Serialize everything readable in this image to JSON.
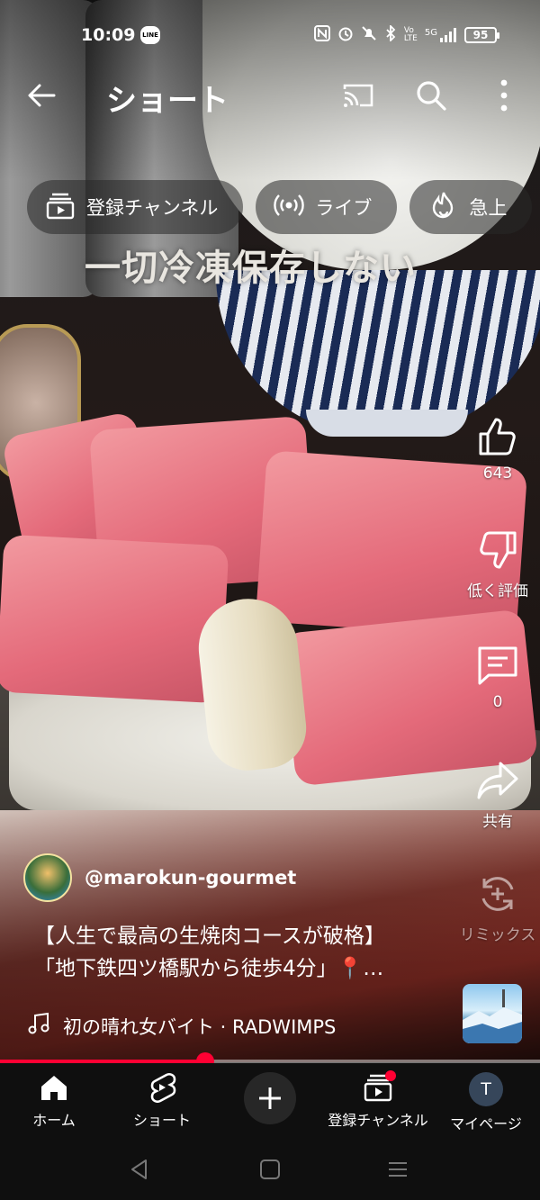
{
  "status_bar": {
    "time": "10:09",
    "line_badge": "LINE",
    "network": "5G",
    "battery": "95"
  },
  "app_bar": {
    "title": "ショート"
  },
  "chips": [
    {
      "label": "登録チャンネル",
      "icon": "subscriptions-icon"
    },
    {
      "label": "ライブ",
      "icon": "live-icon"
    },
    {
      "label": "急上",
      "icon": "trending-icon"
    }
  ],
  "video": {
    "caption_overlay": "一切冷凍保存しない",
    "channel_handle": "@marokun-gourmet",
    "description_line1": "【人生で最高の生焼肉コースが破格】",
    "description_line2": "「地下鉄四ツ橋駅から徒歩4分」📍…",
    "music": "初の晴れ女バイト · RADWIMPS",
    "progress_fraction": 0.38
  },
  "actions": {
    "like_count": "643",
    "dislike_label": "低く評価",
    "comment_count": "0",
    "share_label": "共有",
    "remix_label": "リミックス"
  },
  "bottom_nav": {
    "home": "ホーム",
    "shorts": "ショート",
    "subscriptions": "登録チャンネル",
    "profile": "マイページ",
    "profile_initial": "T"
  },
  "colors": {
    "accent": "#ff0033",
    "nav_background": "#0f0f0f"
  }
}
